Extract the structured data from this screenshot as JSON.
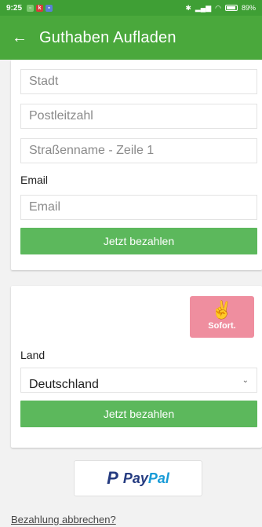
{
  "status_bar": {
    "time": "9:25",
    "battery": "89%"
  },
  "app_bar": {
    "title": "Guthaben Aufladen"
  },
  "card1": {
    "stadt_placeholder": "Stadt",
    "plz_placeholder": "Postleitzahl",
    "street_placeholder": "Straßenname - Zeile 1",
    "email_label": "Email",
    "email_placeholder": "Email",
    "pay_button": "Jetzt bezahlen"
  },
  "card2": {
    "sofort_brand": "Sofort.",
    "land_label": "Land",
    "land_value": "Deutschland",
    "pay_button": "Jetzt bezahlen"
  },
  "paypal": {
    "word_a": "Pay",
    "word_b": "Pal"
  },
  "cancel_link": "Bezahlung abbrechen?",
  "colors": {
    "appbar": "#4aa83c",
    "statusbar": "#3f9f35",
    "button": "#5cb85c",
    "sofort": "#ef8e9f"
  },
  "icons": [
    "back-arrow-icon",
    "sofort-hand-icon",
    "paypal-p-icon",
    "chevron-down-icon"
  ]
}
